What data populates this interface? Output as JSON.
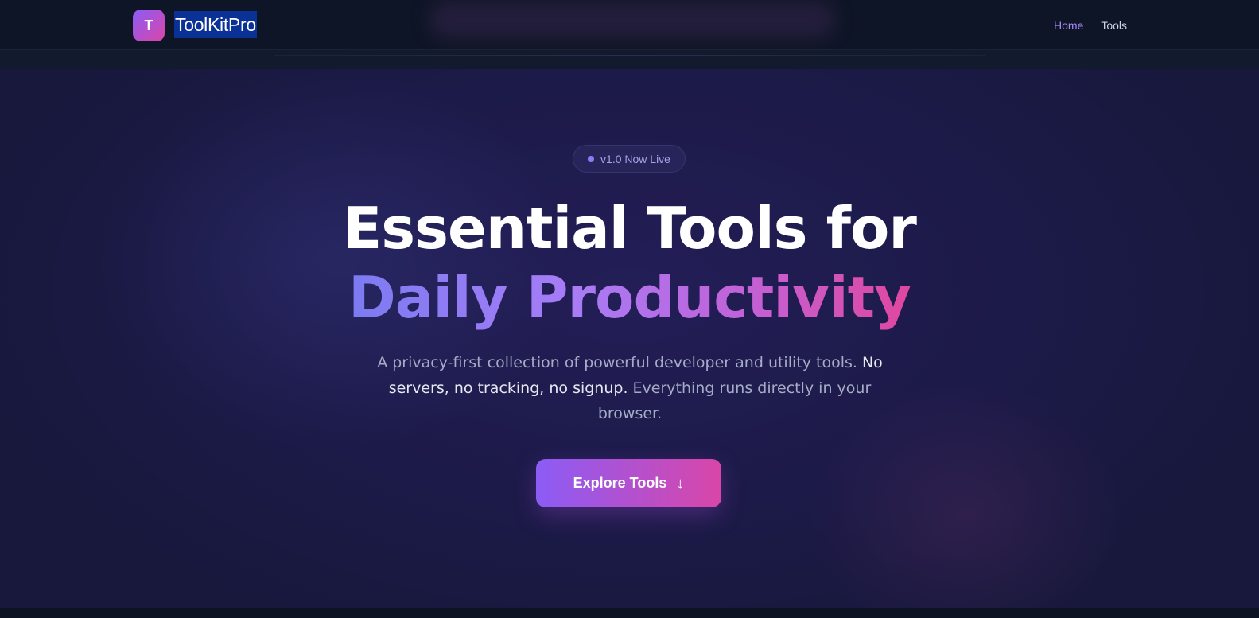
{
  "header": {
    "logo_letter": "T",
    "brand": "ToolKitPro",
    "nav": [
      {
        "label": "Home",
        "active": true
      },
      {
        "label": "Tools",
        "active": false
      }
    ]
  },
  "hero": {
    "badge": "v1.0 Now Live",
    "headline_line1": "Essential Tools for",
    "headline_line2": "Daily Productivity",
    "subtitle_part1": "A privacy-first collection of powerful developer and utility tools.",
    "subtitle_part2": "No servers, no tracking, no signup.",
    "subtitle_part3": "Everything runs directly in your browser.",
    "cta_label": "Explore Tools",
    "cta_icon": "arrow-down-icon"
  },
  "colors": {
    "accent_start": "#8b5cf6",
    "accent_end": "#d946a8",
    "nav_active": "#a78bfa",
    "background": "#0e1526",
    "hero_background": "#1c1a48"
  }
}
